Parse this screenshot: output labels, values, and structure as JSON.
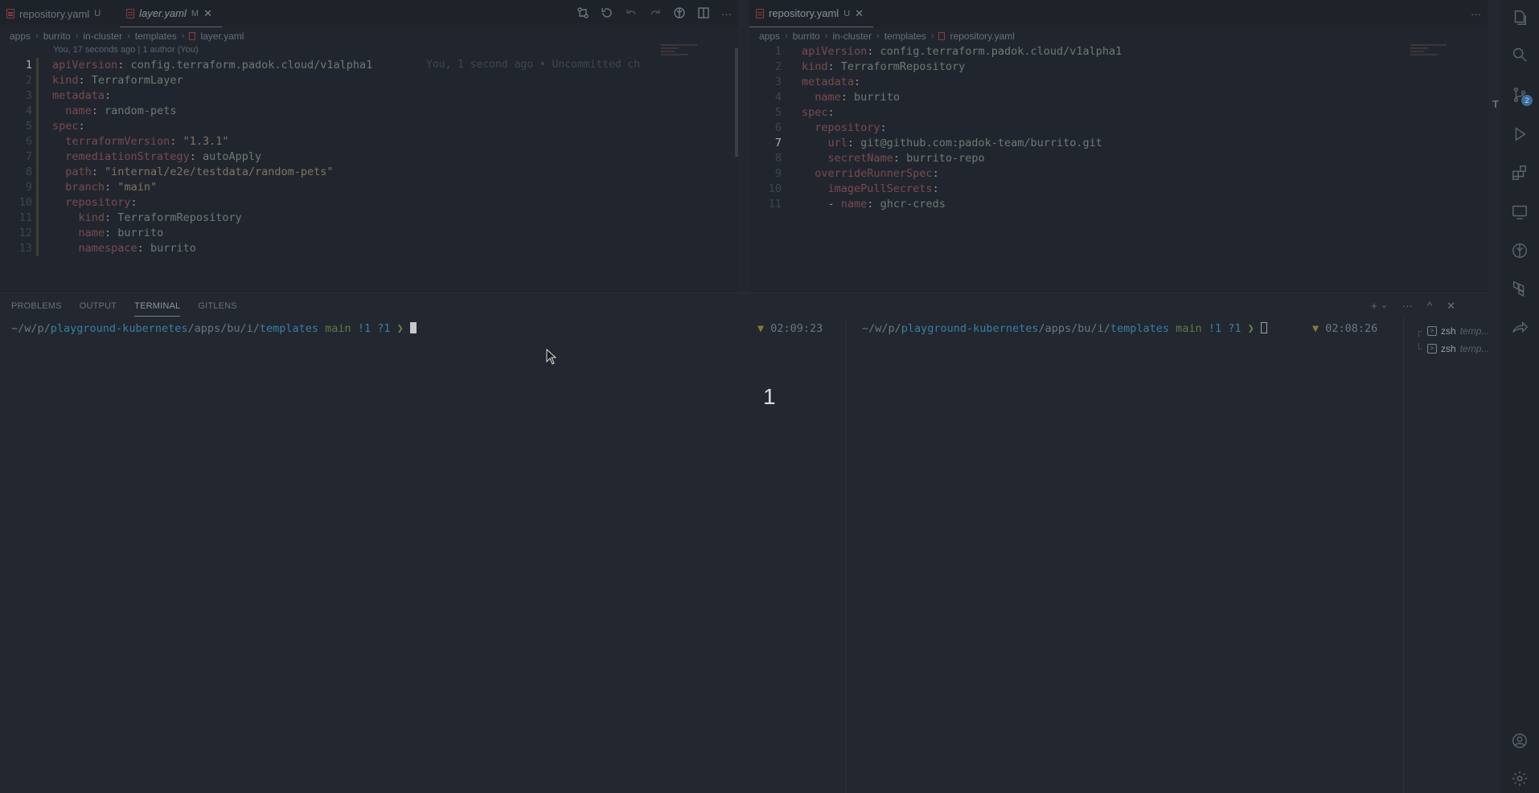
{
  "left_editor": {
    "tabs": [
      {
        "label": "repository.yaml",
        "status": "U"
      },
      {
        "label": "layer.yaml",
        "status": "M",
        "close": "✕"
      }
    ],
    "breadcrumb": [
      "apps",
      "burrito",
      "in-cluster",
      "templates",
      "layer.yaml"
    ],
    "blame_header": "You, 17 seconds ago | 1 author (You)",
    "inline_blame": "You, 1 second ago • Uncommitted ch",
    "current_line": 1,
    "lines": [
      {
        "n": "1",
        "text": "apiVersion: config.terraform.padok.cloud/v1alpha1"
      },
      {
        "n": "2",
        "text": "kind: TerraformLayer"
      },
      {
        "n": "3",
        "text": "metadata:"
      },
      {
        "n": "4",
        "text": "  name: random-pets"
      },
      {
        "n": "5",
        "text": "spec:"
      },
      {
        "n": "6",
        "text": "  terraformVersion: \"1.3.1\""
      },
      {
        "n": "7",
        "text": "  remediationStrategy: autoApply"
      },
      {
        "n": "8",
        "text": "  path: \"internal/e2e/testdata/random-pets\""
      },
      {
        "n": "9",
        "text": "  branch: \"main\""
      },
      {
        "n": "10",
        "text": "  repository:"
      },
      {
        "n": "11",
        "text": "    kind: TerraformRepository"
      },
      {
        "n": "12",
        "text": "    name: burrito"
      },
      {
        "n": "13",
        "text": "    namespace: burrito"
      }
    ]
  },
  "right_editor": {
    "tabs": [
      {
        "label": "repository.yaml",
        "status": "U",
        "close": "✕"
      }
    ],
    "breadcrumb": [
      "apps",
      "burrito",
      "in-cluster",
      "templates",
      "repository.yaml"
    ],
    "current_line": 7,
    "lines": [
      {
        "n": "1",
        "text": "apiVersion: config.terraform.padok.cloud/v1alpha1"
      },
      {
        "n": "2",
        "text": "kind: TerraformRepository"
      },
      {
        "n": "3",
        "text": "metadata:"
      },
      {
        "n": "4",
        "text": "  name: burrito"
      },
      {
        "n": "5",
        "text": "spec:"
      },
      {
        "n": "6",
        "text": "  repository:"
      },
      {
        "n": "7",
        "text": "    url: git@github.com:padok-team/burrito.git"
      },
      {
        "n": "8",
        "text": "    secretName: burrito-repo"
      },
      {
        "n": "9",
        "text": "  overrideRunnerSpec:"
      },
      {
        "n": "10",
        "text": "    imagePullSecrets:"
      },
      {
        "n": "11",
        "text": "    - name: ghcr-creds"
      }
    ],
    "more_actions": "···"
  },
  "panel": {
    "tabs": [
      "PROBLEMS",
      "OUTPUT",
      "TERMINAL",
      "GITLENS"
    ],
    "active_tab": "TERMINAL",
    "actions": {
      "new": "+",
      "dropdown": "⌄",
      "more": "···",
      "maximize": "^",
      "close": "✕"
    }
  },
  "terminals": [
    {
      "prompt_prefix": "~/w/p/",
      "repo": "playground-kubernetes",
      "mid": "/apps/bu/i/",
      "dir": "templates",
      "branch": "main",
      "status": "!1 ?1",
      "arrow": "❯",
      "time_marker": "▼",
      "time": "02:09:23"
    },
    {
      "prompt_prefix": "~/w/p/",
      "repo": "playground-kubernetes",
      "mid": "/apps/bu/i/",
      "dir": "templates",
      "branch": "main",
      "status": "!1 ?1",
      "arrow": "❯",
      "time_marker": "▼",
      "time": "02:08:26"
    }
  ],
  "terminal_list": [
    {
      "name": "zsh",
      "desc": "temp..."
    },
    {
      "name": "zsh",
      "desc": "temp..."
    }
  ],
  "overlay_number": "1",
  "activity_bar": {
    "scm_badge": "2",
    "side_letter": "T"
  }
}
